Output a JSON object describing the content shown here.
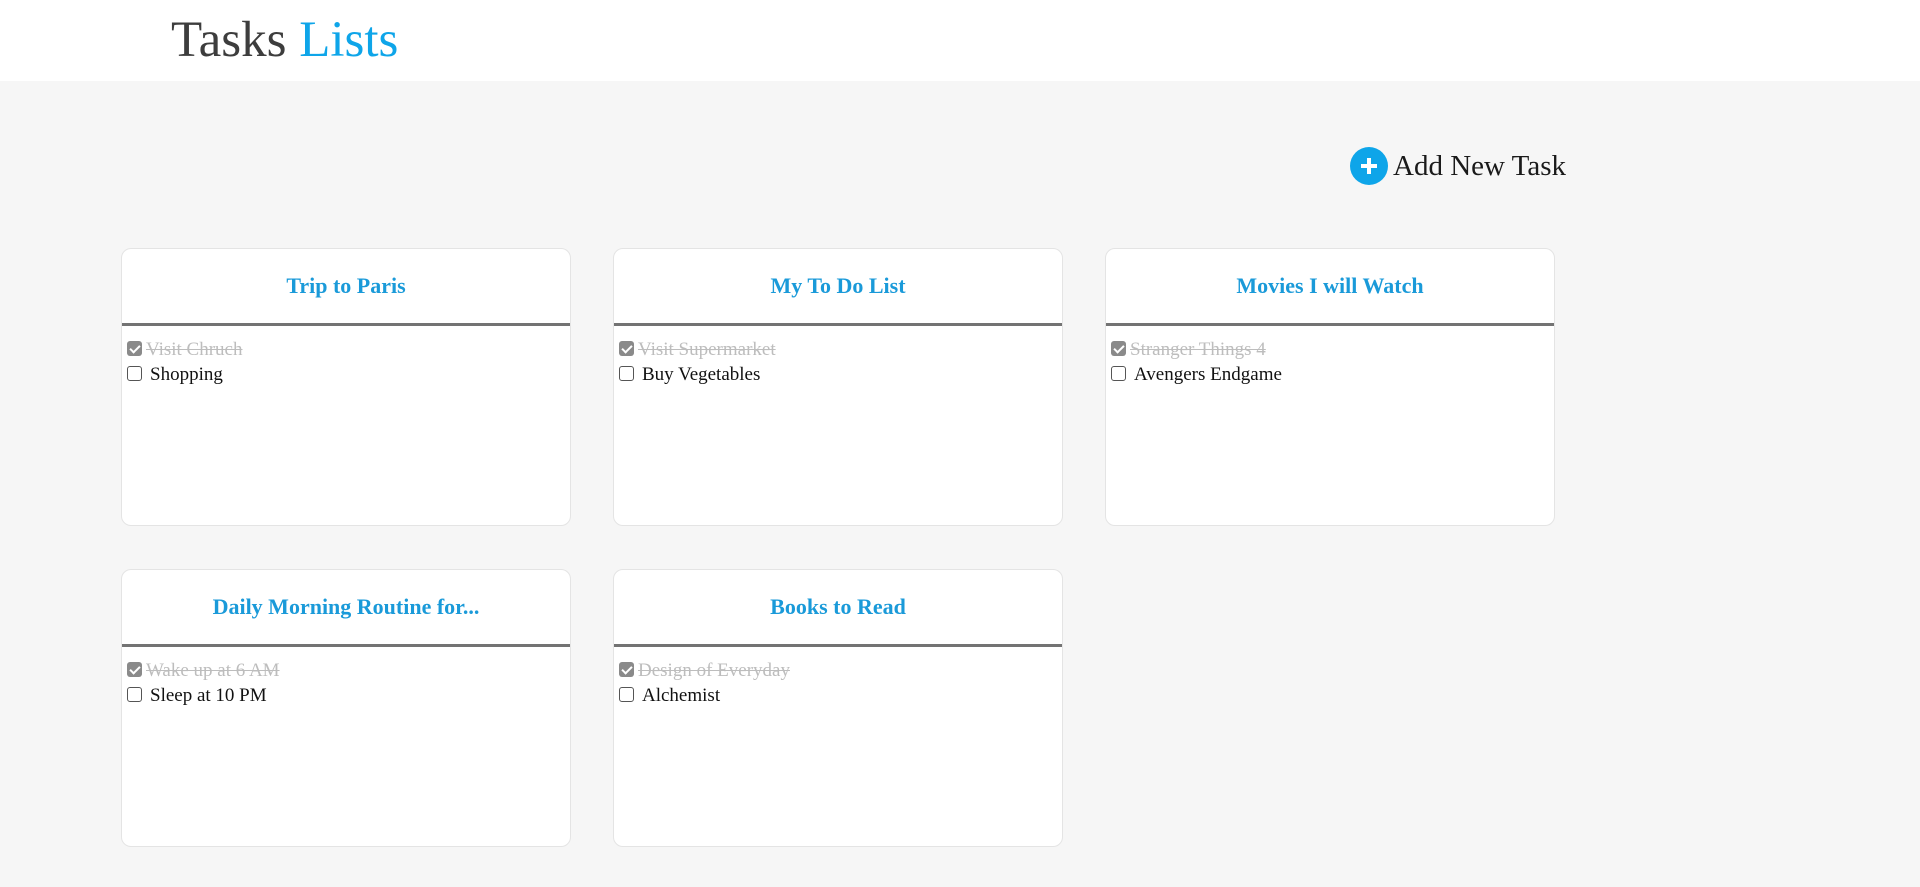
{
  "header": {
    "title_part1": "Tasks",
    "title_part2": "Lists"
  },
  "add_task": {
    "label": "Add New Task",
    "icon": "plus-circle-icon"
  },
  "colors": {
    "accent": "#0ea5e9",
    "card_title": "#1a9ad9",
    "background": "#f6f6f6",
    "done_text": "#bdbdbd"
  },
  "lists": [
    {
      "title": "Trip to Paris",
      "tasks": [
        {
          "text": "Visit Chruch",
          "done": true
        },
        {
          "text": "Shopping",
          "done": false
        }
      ]
    },
    {
      "title": "My To Do List",
      "tasks": [
        {
          "text": "Visit Supermarket",
          "done": true
        },
        {
          "text": "Buy Vegetables",
          "done": false
        }
      ]
    },
    {
      "title": "Movies I will Watch",
      "tasks": [
        {
          "text": "Stranger Things 4",
          "done": true
        },
        {
          "text": "Avengers Endgame",
          "done": false
        }
      ]
    },
    {
      "title": "Daily Morning Routine for...",
      "tasks": [
        {
          "text": "Wake up at 6 AM",
          "done": true
        },
        {
          "text": "Sleep at 10 PM",
          "done": false
        }
      ]
    },
    {
      "title": "Books to Read",
      "tasks": [
        {
          "text": "Design of Everyday",
          "done": true
        },
        {
          "text": "Alchemist",
          "done": false
        }
      ]
    }
  ]
}
